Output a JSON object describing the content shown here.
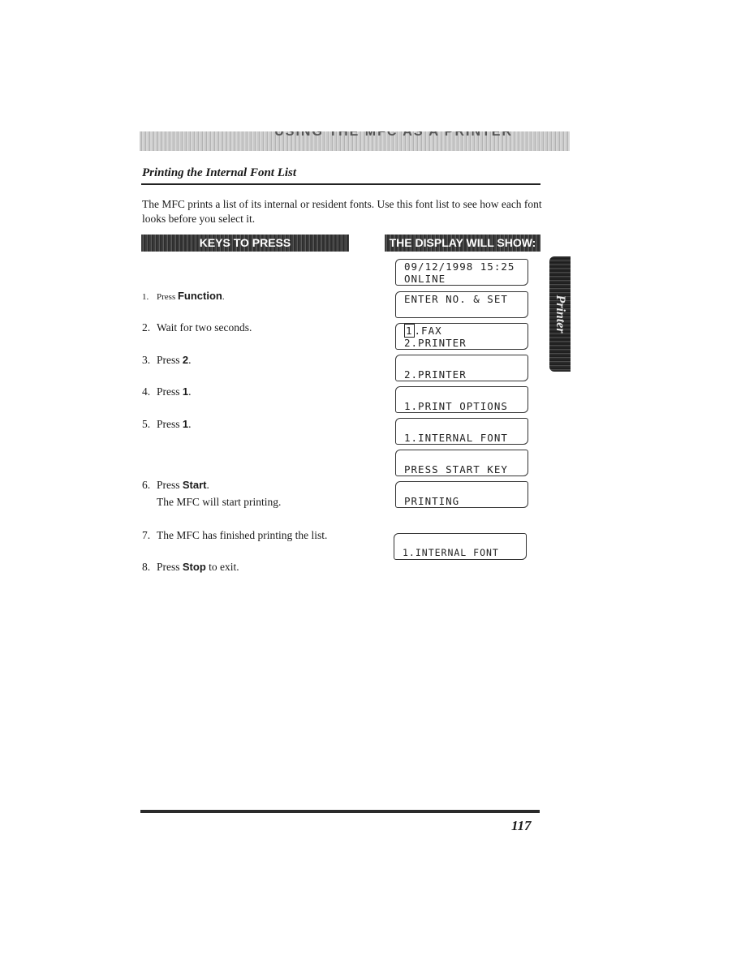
{
  "header": {
    "chapter_title": "USING THE MFC AS A PRINTER"
  },
  "section": {
    "title": "Printing the Internal Font List",
    "intro": "The MFC prints a list of its internal or resident fonts. Use this font list to see how each font looks before you select it."
  },
  "columns": {
    "keys_heading": "KEYS TO PRESS",
    "display_heading": "THE DISPLAY WILL SHOW:"
  },
  "steps": [
    {
      "num": "1.",
      "pre": "Press ",
      "key": "Function",
      "post": "."
    },
    {
      "num": "2.",
      "pre": "Wait for two seconds.",
      "key": "",
      "post": ""
    },
    {
      "num": "3.",
      "pre": "Press ",
      "key": "2",
      "post": "."
    },
    {
      "num": "4.",
      "pre": "Press ",
      "key": "1",
      "post": "."
    },
    {
      "num": "5.",
      "pre": "Press ",
      "key": "1",
      "post": "."
    },
    {
      "num": "6.",
      "pre": "Press ",
      "key": "Start",
      "post": ".",
      "sub": "The MFC will start printing."
    },
    {
      "num": "7.",
      "pre": "The MFC has finished printing the list.",
      "key": "",
      "post": ""
    },
    {
      "num": "8.",
      "pre": "Press ",
      "key": "Stop",
      "post": " to exit."
    }
  ],
  "displays": [
    {
      "line1": "09/12/1998 15:25",
      "line2": "ONLINE"
    },
    {
      "line1": "ENTER NO. & SET",
      "line2": ""
    },
    {
      "line1_box": "1",
      "line1": ".FAX",
      "line2": "2.PRINTER"
    },
    {
      "line1": "",
      "line2": "2.PRINTER"
    },
    {
      "line1": "",
      "line2": "1.PRINT OPTIONS"
    },
    {
      "line1": "",
      "line2": "1.INTERNAL FONT"
    },
    {
      "line1": "",
      "line2": "PRESS START KEY"
    },
    {
      "line1": "",
      "line2": "PRINTING"
    },
    {
      "line1": "",
      "line2": "1.INTERNAL FONT"
    }
  ],
  "side_tab": {
    "label": "Printer"
  },
  "footer": {
    "page_number": "117"
  }
}
